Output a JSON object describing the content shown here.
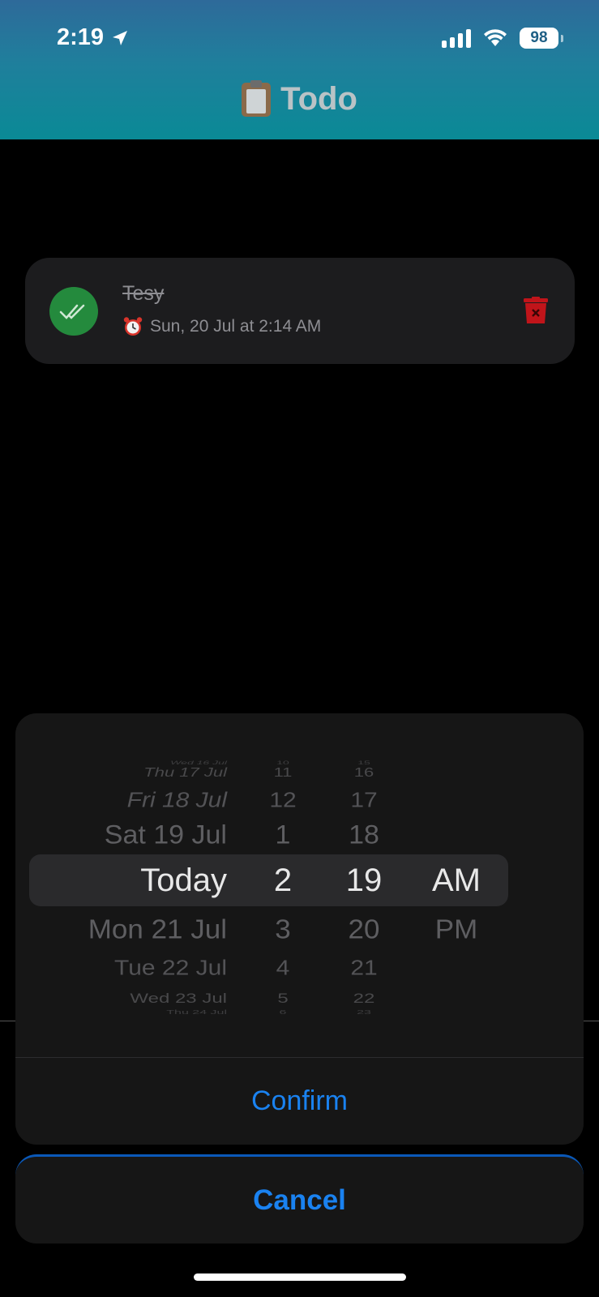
{
  "status_bar": {
    "time": "2:19",
    "battery": "98"
  },
  "header": {
    "title": "Todo"
  },
  "todo_items": [
    {
      "title": "Tesy",
      "due": "Sun, 20 Jul at 2:14 AM",
      "completed": true
    }
  ],
  "picker": {
    "rows": [
      {
        "date": "Wed 16 Jul",
        "hour": "10",
        "minute": "15",
        "period": ""
      },
      {
        "date": "Thu 17 Jul",
        "hour": "11",
        "minute": "16",
        "period": ""
      },
      {
        "date": "Fri 18 Jul",
        "hour": "12",
        "minute": "17",
        "period": ""
      },
      {
        "date": "Sat 19 Jul",
        "hour": "1",
        "minute": "18",
        "period": ""
      },
      {
        "date": "Today",
        "hour": "2",
        "minute": "19",
        "period": "AM"
      },
      {
        "date": "Mon 21 Jul",
        "hour": "3",
        "minute": "20",
        "period": "PM"
      },
      {
        "date": "Tue 22 Jul",
        "hour": "4",
        "minute": "21",
        "period": ""
      },
      {
        "date": "Wed 23 Jul",
        "hour": "5",
        "minute": "22",
        "period": ""
      },
      {
        "date": "Thu 24 Jul",
        "hour": "6",
        "minute": "23",
        "period": ""
      }
    ],
    "selected_index": 4,
    "confirm_label": "Confirm",
    "cancel_label": "Cancel"
  },
  "colors": {
    "accent": "#1a82f0",
    "complete_green": "#248a3d",
    "delete_red": "#c0141a"
  }
}
